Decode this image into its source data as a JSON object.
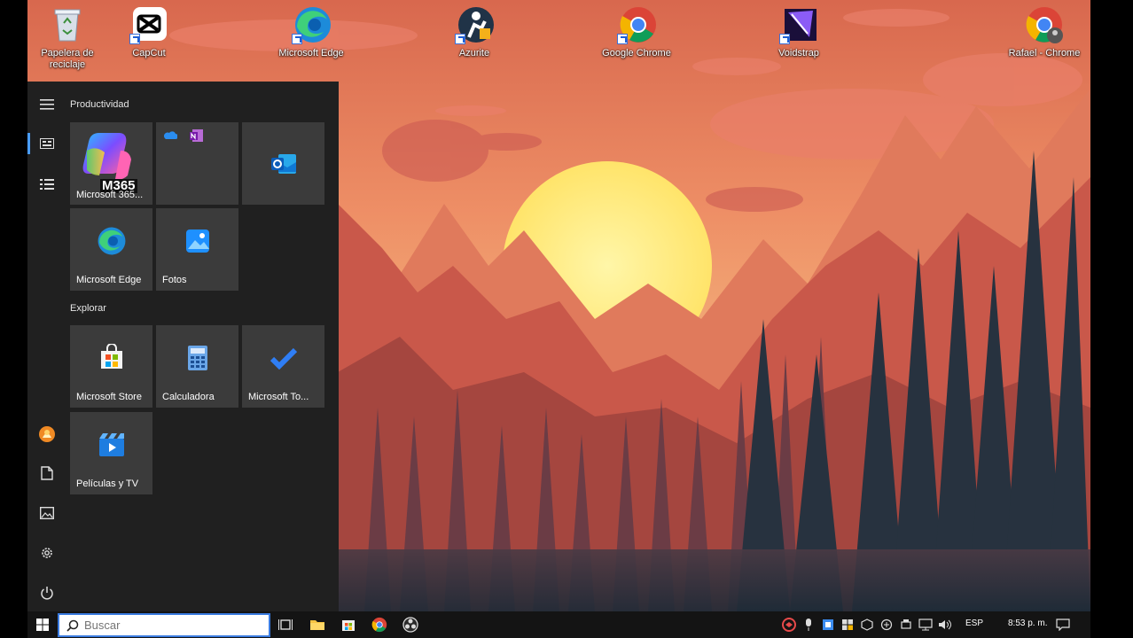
{
  "desktop": {
    "icons": [
      {
        "label": "Papelera de reciclaje",
        "icon": "recycle-bin-icon"
      },
      {
        "label": "CapCut",
        "icon": "capcut-icon"
      },
      {
        "label": "Microsoft Edge",
        "icon": "edge-icon"
      },
      {
        "label": "Azurite",
        "icon": "azurite-icon"
      },
      {
        "label": "Google Chrome",
        "icon": "chrome-icon"
      },
      {
        "label": "Voidstrap",
        "icon": "voidstrap-icon"
      },
      {
        "label": "Rafael - Chrome",
        "icon": "chrome-profile-icon"
      }
    ]
  },
  "start_menu": {
    "groups": [
      {
        "title": "Productividad"
      },
      {
        "title": "Explorar"
      }
    ],
    "tiles": {
      "m365": {
        "label": "Microsoft 365...",
        "badge": "M365"
      },
      "office_mini": {
        "label": ""
      },
      "outlook": {
        "label": ""
      },
      "edge": {
        "label": "Microsoft Edge"
      },
      "fotos": {
        "label": "Fotos"
      },
      "store": {
        "label": "Microsoft Store"
      },
      "calc": {
        "label": "Calculadora"
      },
      "todo": {
        "label": "Microsoft To..."
      },
      "movies": {
        "label": "Películas y TV"
      }
    }
  },
  "taskbar": {
    "search_placeholder": "Buscar",
    "language": "ESP",
    "clock": "8:53 p. m."
  },
  "colors": {
    "accent": "#4a9dff",
    "start_bg": "#202020",
    "tile_bg": "#3b3b3b",
    "taskbar_bg": "#141414"
  }
}
